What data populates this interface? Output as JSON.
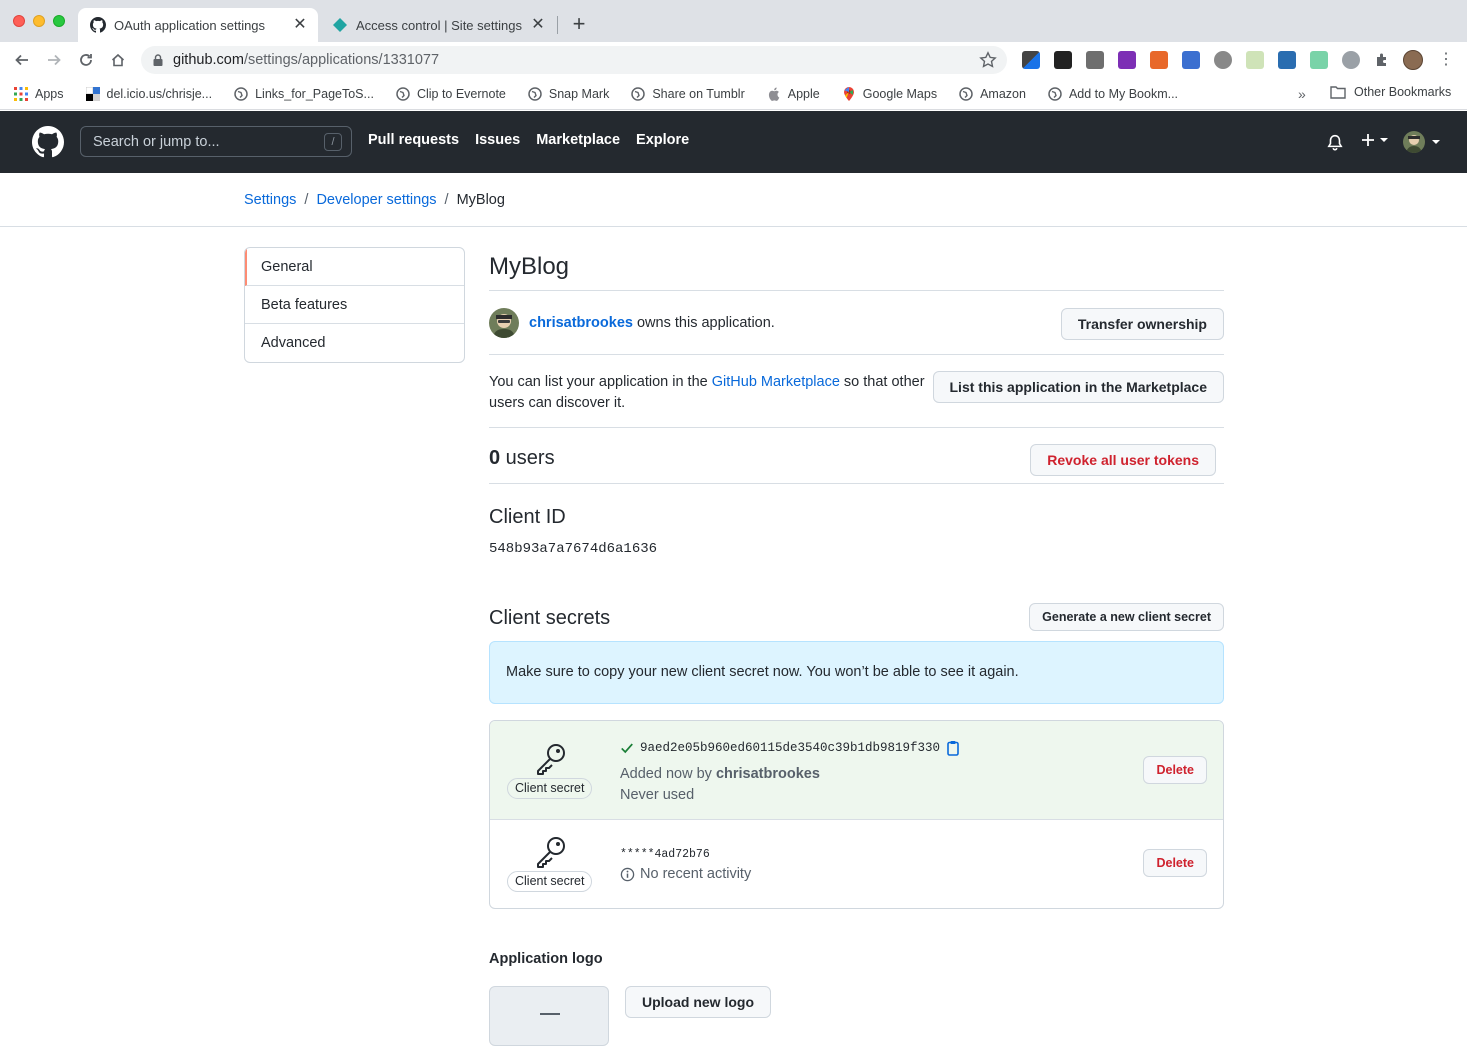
{
  "browser": {
    "tabs": [
      {
        "title": "OAuth application settings",
        "icon": "github-icon"
      },
      {
        "title": "Access control | Site settings",
        "icon": "netlify-icon"
      }
    ],
    "url_host": "github.com",
    "url_path": "/settings/applications/1331077",
    "bookmarks": [
      {
        "label": "Apps",
        "icon": "apps-grid-icon"
      },
      {
        "label": "del.icio.us/chrisje...",
        "icon": "delicious-icon"
      },
      {
        "label": "Links_for_PageToS...",
        "icon": "globe-icon"
      },
      {
        "label": "Clip to Evernote",
        "icon": "globe-icon"
      },
      {
        "label": "Snap Mark",
        "icon": "globe-icon"
      },
      {
        "label": "Share on Tumblr",
        "icon": "globe-icon"
      },
      {
        "label": "Apple",
        "icon": "apple-icon"
      },
      {
        "label": "Google Maps",
        "icon": "maps-pin-icon"
      },
      {
        "label": "Amazon",
        "icon": "globe-icon"
      },
      {
        "label": "Add to My Bookm...",
        "icon": "globe-icon"
      }
    ],
    "bookmarks_overflow": "»",
    "other_bookmarks": "Other Bookmarks"
  },
  "github": {
    "search_placeholder": "Search or jump to...",
    "search_shortcut": "/",
    "nav": [
      "Pull requests",
      "Issues",
      "Marketplace",
      "Explore"
    ]
  },
  "breadcrumb": {
    "settings": "Settings",
    "developer": "Developer settings",
    "current": "MyBlog",
    "separator": "/"
  },
  "sidebar": {
    "items": [
      {
        "label": "General",
        "selected": true
      },
      {
        "label": "Beta features",
        "selected": false
      },
      {
        "label": "Advanced",
        "selected": false
      }
    ]
  },
  "app": {
    "name": "MyBlog",
    "owner": "chrisatbrookes",
    "owner_suffix": " owns this application.",
    "transfer_label": "Transfer ownership",
    "market_prefix": "You can list your application in the ",
    "market_link": "GitHub Marketplace",
    "market_suffix": " so that other users can discover it.",
    "market_button": "List this application in the Marketplace",
    "users_count": "0",
    "users_label": " users",
    "revoke_label": "Revoke all user tokens",
    "client_id_title": "Client ID",
    "client_id": "548b93a7a7674d6a1636",
    "secrets_title": "Client secrets",
    "generate_label": "Generate a new client secret",
    "flash_message": "Make sure to copy your new client secret now. You won’t be able to see it again.",
    "secrets": [
      {
        "label": "Client secret",
        "value": "9aed2e05b960ed60115de3540c39b1db9819f330",
        "added_prefix": "Added now by ",
        "added_by": "chrisatbrookes",
        "usage": "Never used",
        "delete_label": "Delete"
      },
      {
        "label": "Client secret",
        "masked": "*****4ad72b76",
        "activity": "No recent activity",
        "delete_label": "Delete"
      }
    ],
    "logo_title": "Application logo",
    "upload_label": "Upload new logo"
  },
  "colors": {
    "link": "#0969da",
    "danger": "#cf222e",
    "header_bg": "#24292f",
    "flash_bg": "#ddf4ff",
    "new_secret_bg": "#eef7ee",
    "success": "#1a7f37"
  }
}
